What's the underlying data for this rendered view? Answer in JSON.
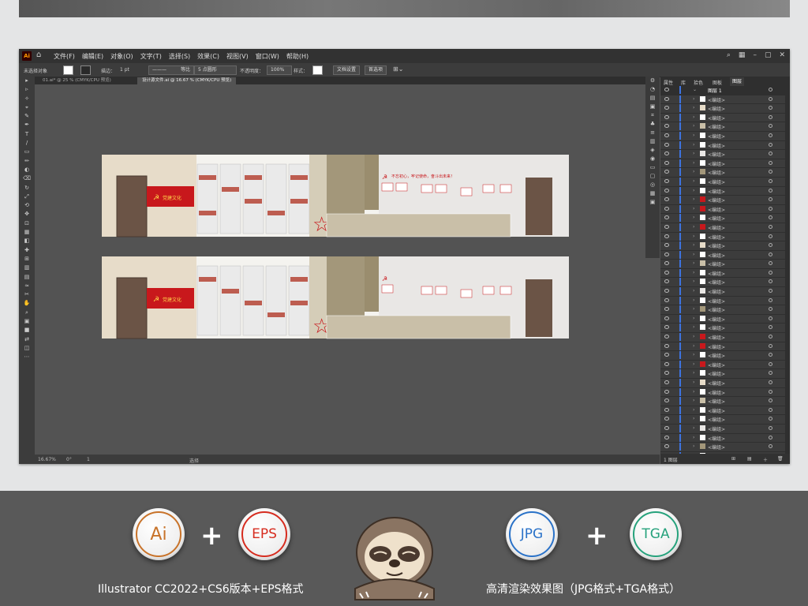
{
  "app": {
    "logo": "Ai",
    "menus": [
      "文件(F)",
      "编辑(E)",
      "对象(O)",
      "文字(T)",
      "选择(S)",
      "效果(C)",
      "视图(V)",
      "窗口(W)",
      "帮助(H)"
    ]
  },
  "controlbar": {
    "selection": "未选择对象",
    "stroke_width": "1 pt",
    "stroke_style": "等比",
    "brush": "5 点圆形",
    "opacity_label": "不透明度：",
    "opacity": "100%",
    "style_label": "样式：",
    "doc_settings": "文档设置",
    "preferences": "首选项"
  },
  "tabs": [
    {
      "label": "01.ai* @ 25 % (CMYK/CPU 预览)",
      "active": false
    },
    {
      "label": "设计源文件.ai @ 16.67 % (CMYK/CPU 预览)",
      "active": true
    }
  ],
  "status": {
    "zoom": "16.67%",
    "angle": "0°",
    "page": "1",
    "tool": "选择"
  },
  "panel": {
    "tabs": [
      "属性",
      "库",
      "拾色",
      "图板",
      "图层"
    ],
    "active_tab": "图层",
    "top_layer": "图层 1",
    "sublayer_label": "<编组>",
    "sublayer_count": 42,
    "footer": "1 图层"
  },
  "artwork": {
    "banner_text": "党建文化",
    "slogans": "不忘初心，牢记使命，奋斗出未来！",
    "vertical_text_1": "党的光辉照耀",
    "vertical_text_2": "入党誓词"
  },
  "bottom": {
    "badges": [
      {
        "text": "Ai",
        "color": "#c8732a"
      },
      {
        "text": "EPS",
        "color": "#d62c1f"
      },
      {
        "text": "JPG",
        "color": "#2a72c8"
      },
      {
        "text": "TGA",
        "color": "#26a27c"
      }
    ],
    "plus": "+",
    "caption_left": "Illustrator CC2022+CS6版本+EPS格式",
    "caption_right": "高清渲染效果图（JPG格式+TGA格式）"
  }
}
